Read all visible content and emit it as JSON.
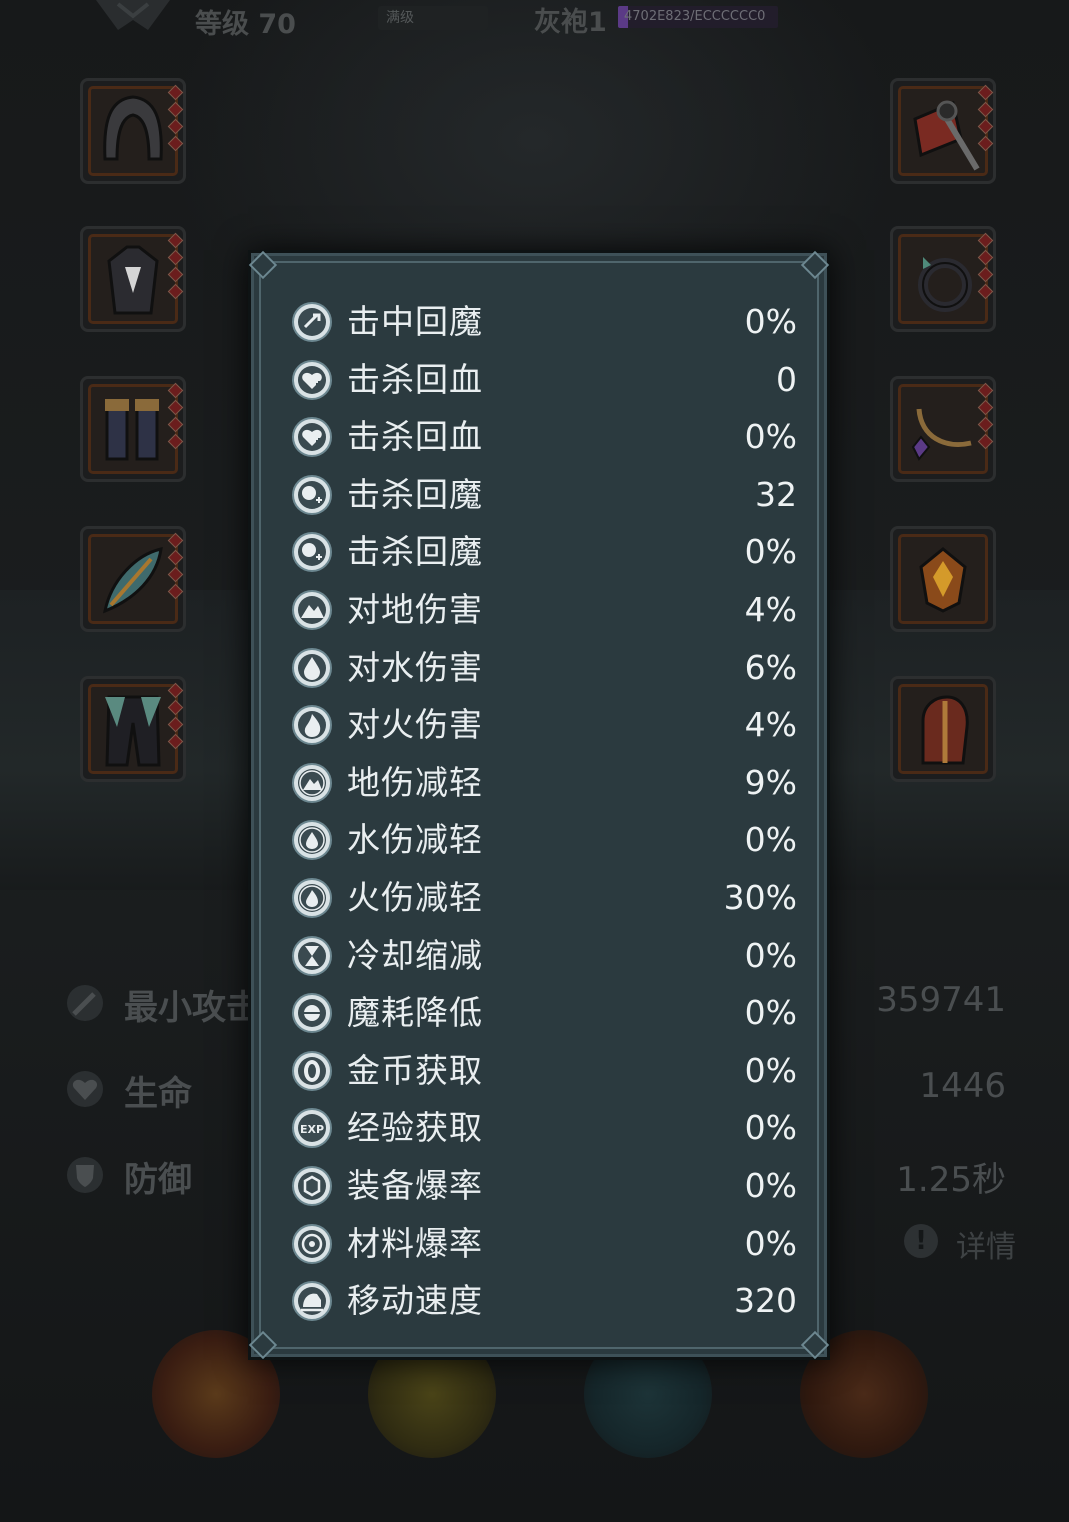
{
  "header": {
    "level_text": "等级 70",
    "max_level_chip": "满级",
    "player_name": "灰袍1",
    "exp_text": "4702E823/ECCCCCC0",
    "exp_fraction": 0.06
  },
  "equipment_left": [
    {
      "name": "hood",
      "icon": "hood-icon"
    },
    {
      "name": "cloak",
      "icon": "cloak-icon"
    },
    {
      "name": "boots",
      "icon": "boots-icon"
    },
    {
      "name": "feather",
      "icon": "feather-icon"
    },
    {
      "name": "pants",
      "icon": "pants-icon"
    }
  ],
  "equipment_right": [
    {
      "name": "weapon",
      "icon": "axe-icon"
    },
    {
      "name": "ring",
      "icon": "ring-icon"
    },
    {
      "name": "necklace",
      "icon": "necklace-icon"
    },
    {
      "name": "emblem",
      "icon": "emblem-icon"
    },
    {
      "name": "helmet",
      "icon": "helmet-icon"
    }
  ],
  "background_stats": [
    {
      "label": "最小攻击",
      "value": "359741"
    },
    {
      "label": "生命",
      "value": "1446"
    },
    {
      "label": "防御",
      "value": "1.25秒"
    }
  ],
  "detail_label": "详情",
  "stats_panel": {
    "rows": [
      {
        "label": "击中回魔",
        "value": "0%",
        "icon": "mana-hit-icon"
      },
      {
        "label": "击杀回血",
        "value": "0",
        "icon": "heart-plus-icon"
      },
      {
        "label": "击杀回血",
        "value": "0%",
        "icon": "heart-plus-icon"
      },
      {
        "label": "击杀回魔",
        "value": "32",
        "icon": "mana-plus-icon"
      },
      {
        "label": "击杀回魔",
        "value": "0%",
        "icon": "mana-plus-icon"
      },
      {
        "label": "对地伤害",
        "value": "4%",
        "icon": "earth-icon"
      },
      {
        "label": "对水伤害",
        "value": "6%",
        "icon": "water-icon"
      },
      {
        "label": "对火伤害",
        "value": "4%",
        "icon": "fire-icon"
      },
      {
        "label": "地伤减轻",
        "value": "9%",
        "icon": "earth-shield-icon"
      },
      {
        "label": "水伤减轻",
        "value": "0%",
        "icon": "water-shield-icon"
      },
      {
        "label": "火伤减轻",
        "value": "30%",
        "icon": "fire-shield-icon"
      },
      {
        "label": "冷却缩减",
        "value": "0%",
        "icon": "hourglass-icon"
      },
      {
        "label": "魔耗降低",
        "value": "0%",
        "icon": "mana-cost-icon"
      },
      {
        "label": "金币获取",
        "value": "0%",
        "icon": "coin-icon"
      },
      {
        "label": "经验获取",
        "value": "0%",
        "icon": "exp-icon"
      },
      {
        "label": "装备爆率",
        "value": "0%",
        "icon": "equip-drop-icon"
      },
      {
        "label": "材料爆率",
        "value": "0%",
        "icon": "material-drop-icon"
      },
      {
        "label": "移动速度",
        "value": "320",
        "icon": "speed-icon"
      }
    ]
  },
  "colors": {
    "panel_bg": "#2b3a3f",
    "panel_border": "#4f656c",
    "text": "#e9eef0",
    "slot_border": "#4a2a16"
  }
}
